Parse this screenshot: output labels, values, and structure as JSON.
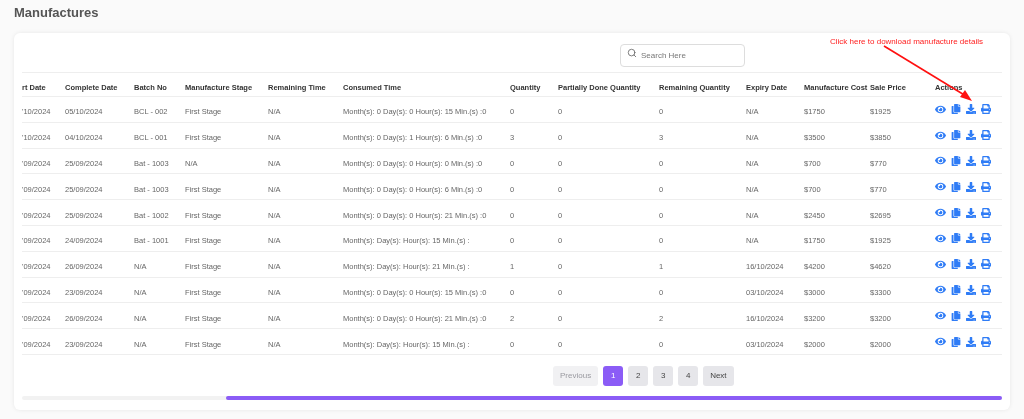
{
  "page_title": "Manufactures",
  "search": {
    "placeholder": "Search Here"
  },
  "annotation": "Click here to download manufacture details",
  "table": {
    "columns": [
      "rt Date",
      "Complete Date",
      "Batch No",
      "Manufacture Stage",
      "Remaining Time",
      "Consumed Time",
      "Quantity",
      "Partially Done Quantity",
      "Remaining Quantity",
      "Expiry Date",
      "Manufacture Cost",
      "Sale Price",
      "Actions"
    ],
    "rows": [
      {
        "cells": [
          "'10/2024",
          "05/10/2024",
          "BCL - 002",
          "First Stage",
          "N/A",
          "Month(s): 0 Day(s): 0 Hour(s): 15 Min.(s) :0",
          "0",
          "0",
          "0",
          "N/A",
          "$1750",
          "$1925"
        ]
      },
      {
        "cells": [
          "'10/2024",
          "04/10/2024",
          "BCL - 001",
          "First Stage",
          "N/A",
          "Month(s): 0 Day(s): 1 Hour(s): 6 Min.(s) :0",
          "3",
          "0",
          "3",
          "N/A",
          "$3500",
          "$3850"
        ]
      },
      {
        "cells": [
          "'09/2024",
          "25/09/2024",
          "Bat - 1003",
          "N/A",
          "N/A",
          "Month(s): 0 Day(s): 0 Hour(s): 0 Min.(s) :0",
          "0",
          "0",
          "0",
          "N/A",
          "$700",
          "$770"
        ]
      },
      {
        "cells": [
          "'09/2024",
          "25/09/2024",
          "Bat - 1003",
          "First Stage",
          "N/A",
          "Month(s): 0 Day(s): 0 Hour(s): 6 Min.(s) :0",
          "0",
          "0",
          "0",
          "N/A",
          "$700",
          "$770"
        ]
      },
      {
        "cells": [
          "'09/2024",
          "25/09/2024",
          "Bat - 1002",
          "First Stage",
          "N/A",
          "Month(s): 0 Day(s): 0 Hour(s): 21 Min.(s) :0",
          "0",
          "0",
          "0",
          "N/A",
          "$2450",
          "$2695"
        ]
      },
      {
        "cells": [
          "'09/2024",
          "24/09/2024",
          "Bat - 1001",
          "First Stage",
          "N/A",
          "Month(s): Day(s): Hour(s): 15 Min.(s) :",
          "0",
          "0",
          "0",
          "N/A",
          "$1750",
          "$1925"
        ]
      },
      {
        "cells": [
          "'09/2024",
          "26/09/2024",
          "N/A",
          "First Stage",
          "N/A",
          "Month(s): Day(s): Hour(s): 21 Min.(s) :",
          "1",
          "0",
          "1",
          "16/10/2024",
          "$4200",
          "$4620"
        ]
      },
      {
        "cells": [
          "'09/2024",
          "23/09/2024",
          "N/A",
          "First Stage",
          "N/A",
          "Month(s): 0 Day(s): 0 Hour(s): 15 Min.(s) :0",
          "0",
          "0",
          "0",
          "03/10/2024",
          "$3000",
          "$3300"
        ]
      },
      {
        "cells": [
          "'09/2024",
          "26/09/2024",
          "N/A",
          "First Stage",
          "N/A",
          "Month(s): 0 Day(s): 0 Hour(s): 21 Min.(s) :0",
          "2",
          "0",
          "2",
          "16/10/2024",
          "$3200",
          "$3200"
        ]
      },
      {
        "cells": [
          "'09/2024",
          "23/09/2024",
          "N/A",
          "First Stage",
          "N/A",
          "Month(s): Day(s): Hour(s): 15 Min.(s) :",
          "0",
          "0",
          "0",
          "03/10/2024",
          "$2000",
          "$2000"
        ]
      }
    ]
  },
  "pagination": {
    "previous": {
      "label": "Previous",
      "disabled": true
    },
    "pages": [
      {
        "label": "1",
        "selected": true
      },
      {
        "label": "2",
        "selected": false
      },
      {
        "label": "3",
        "selected": false
      },
      {
        "label": "4",
        "selected": false
      }
    ],
    "next": {
      "label": "Next",
      "disabled": false
    }
  }
}
